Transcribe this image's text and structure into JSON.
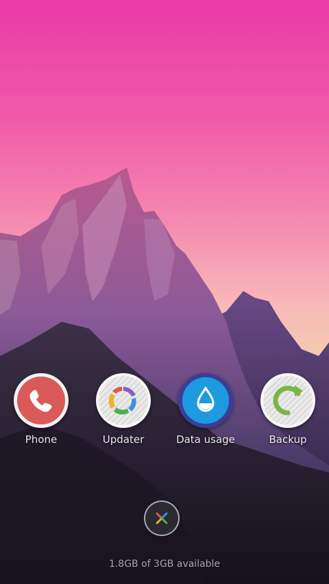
{
  "home_screen": {
    "wallpaper": {
      "subject": "mountain-peaks",
      "sky_colors": [
        "#e83aa8",
        "#f5c9b2"
      ]
    },
    "dock": {
      "apps": [
        {
          "label": "Phone",
          "icon": "phone-icon",
          "color": "#d95a58"
        },
        {
          "label": "Updater",
          "icon": "updater-icon",
          "color": "#e8e8e8"
        },
        {
          "label": "Data usage",
          "icon": "water-drop-icon",
          "color": "#1e9be0"
        },
        {
          "label": "Backup",
          "icon": "refresh-arrow-icon",
          "color": "#7ab648"
        }
      ]
    },
    "app_drawer": {
      "icon": "app-drawer-icon"
    },
    "memory_status": "1.8GB of 3GB available"
  }
}
